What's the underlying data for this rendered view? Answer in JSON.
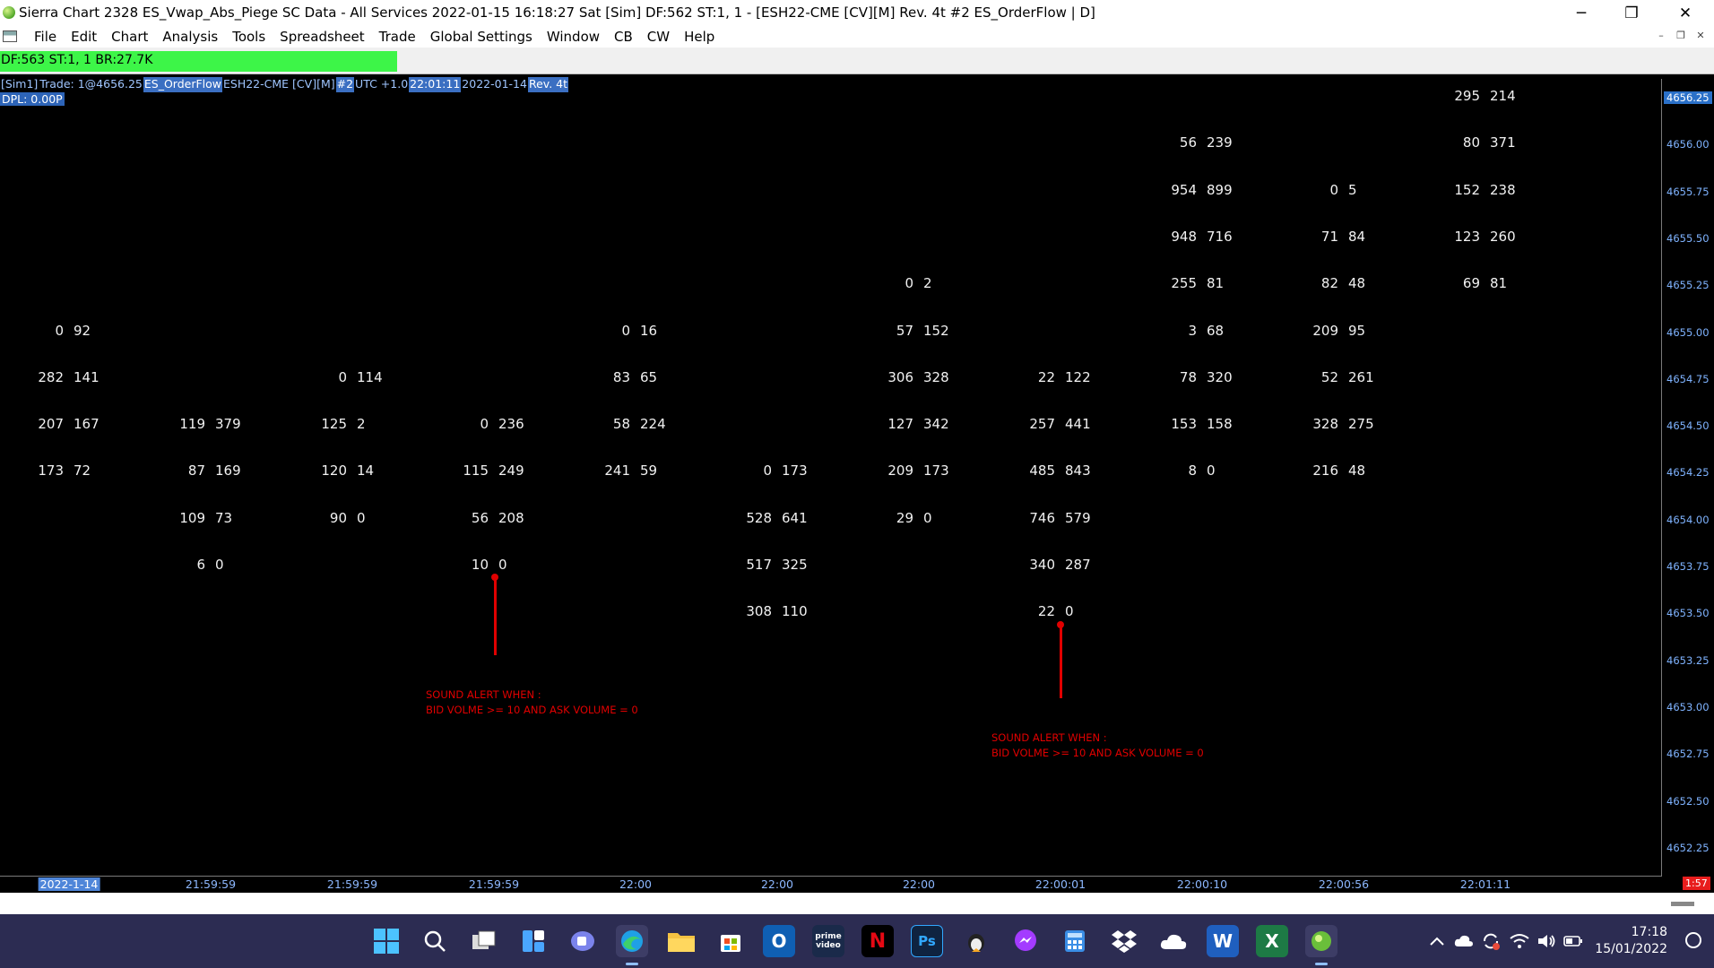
{
  "window": {
    "title": "Sierra Chart 2328 ES_Vwap_Abs_Piege  SC Data - All Services 2022-01-15  16:18:27 Sat [Sim]  DF:562  ST:1, 1 - [ESH22-CME [CV][M]  Rev. 4t  #2 ES_OrderFlow | D]",
    "minimize": "─",
    "restore": "❐",
    "close": "✕"
  },
  "menu": {
    "items": [
      "File",
      "Edit",
      "Chart",
      "Analysis",
      "Tools",
      "Spreadsheet",
      "Trade",
      "Global Settings",
      "Window",
      "CB",
      "CW",
      "Help"
    ],
    "mdi_minimize": "–",
    "mdi_restore": "❐",
    "mdi_close": "✕"
  },
  "controlbar": {
    "status": "DF:563  ST:1, 1   BR:27.7K"
  },
  "chart": {
    "info": {
      "sim": "[Sim1]",
      "trade": "Trade: 1@4656.25",
      "study": "ES_OrderFlow",
      "symbol": "ESH22-CME [CV][M]",
      "chart_num": "#2",
      "tz": "UTC +1.0",
      "time": "22:01:11",
      "date": "2022-01-14",
      "rev": "Rev. 4t"
    },
    "dpl": "DPL: 0.00P",
    "y_labels": [
      "4656.25",
      "4656.00",
      "4655.75",
      "4655.50",
      "4655.25",
      "4655.00",
      "4654.75",
      "4654.50",
      "4654.25",
      "4654.00",
      "4653.75",
      "4653.50",
      "4653.25",
      "4653.00",
      "4652.75",
      "4652.50",
      "4652.25"
    ],
    "x_labels": [
      "2022-1-14",
      "21:59:59",
      "21:59:59",
      "21:59:59",
      "22:00",
      "22:00",
      "22:00",
      "22:00:01",
      "22:00:10",
      "22:00:56",
      "22:01:11"
    ],
    "time_badge": "1:57",
    "footprint": [
      {
        "bar": 0,
        "cells": [
          {
            "price": "4655.00",
            "bid": "0",
            "ask": "92"
          },
          {
            "price": "4654.75",
            "bid": "282",
            "ask": "141"
          },
          {
            "price": "4654.50",
            "bid": "207",
            "ask": "167"
          },
          {
            "price": "4654.25",
            "bid": "173",
            "ask": "72"
          }
        ]
      },
      {
        "bar": 1,
        "cells": [
          {
            "price": "4654.50",
            "bid": "119",
            "ask": "379"
          },
          {
            "price": "4654.25",
            "bid": "87",
            "ask": "169"
          },
          {
            "price": "4654.00",
            "bid": "109",
            "ask": "73"
          },
          {
            "price": "4653.75",
            "bid": "6",
            "ask": "0"
          }
        ]
      },
      {
        "bar": 2,
        "cells": [
          {
            "price": "4654.75",
            "bid": "0",
            "ask": "114"
          },
          {
            "price": "4654.50",
            "bid": "125",
            "ask": "2"
          },
          {
            "price": "4654.25",
            "bid": "120",
            "ask": "14"
          },
          {
            "price": "4654.00",
            "bid": "90",
            "ask": "0"
          }
        ]
      },
      {
        "bar": 3,
        "cells": [
          {
            "price": "4654.50",
            "bid": "0",
            "ask": "236"
          },
          {
            "price": "4654.25",
            "bid": "115",
            "ask": "249"
          },
          {
            "price": "4654.00",
            "bid": "56",
            "ask": "208"
          },
          {
            "price": "4653.75",
            "bid": "10",
            "ask": "0"
          }
        ]
      },
      {
        "bar": 4,
        "cells": [
          {
            "price": "4655.00",
            "bid": "0",
            "ask": "16"
          },
          {
            "price": "4654.75",
            "bid": "83",
            "ask": "65"
          },
          {
            "price": "4654.50",
            "bid": "58",
            "ask": "224"
          },
          {
            "price": "4654.25",
            "bid": "241",
            "ask": "59"
          }
        ]
      },
      {
        "bar": 5,
        "cells": [
          {
            "price": "4654.25",
            "bid": "0",
            "ask": "173"
          },
          {
            "price": "4654.00",
            "bid": "528",
            "ask": "641"
          },
          {
            "price": "4653.75",
            "bid": "517",
            "ask": "325"
          },
          {
            "price": "4653.50",
            "bid": "308",
            "ask": "110"
          }
        ]
      },
      {
        "bar": 6,
        "cells": [
          {
            "price": "4655.25",
            "bid": "0",
            "ask": "2"
          },
          {
            "price": "4655.00",
            "bid": "57",
            "ask": "152"
          },
          {
            "price": "4654.75",
            "bid": "306",
            "ask": "328"
          },
          {
            "price": "4654.50",
            "bid": "127",
            "ask": "342"
          },
          {
            "price": "4654.25",
            "bid": "209",
            "ask": "173"
          },
          {
            "price": "4654.00",
            "bid": "29",
            "ask": "0"
          }
        ]
      },
      {
        "bar": 7,
        "cells": [
          {
            "price": "4654.75",
            "bid": "22",
            "ask": "122"
          },
          {
            "price": "4654.50",
            "bid": "257",
            "ask": "441"
          },
          {
            "price": "4654.25",
            "bid": "485",
            "ask": "843"
          },
          {
            "price": "4654.00",
            "bid": "746",
            "ask": "579"
          },
          {
            "price": "4653.75",
            "bid": "340",
            "ask": "287"
          },
          {
            "price": "4653.50",
            "bid": "22",
            "ask": "0"
          }
        ]
      },
      {
        "bar": 8,
        "cells": [
          {
            "price": "4656.00",
            "bid": "56",
            "ask": "239"
          },
          {
            "price": "4655.75",
            "bid": "954",
            "ask": "899"
          },
          {
            "price": "4655.50",
            "bid": "948",
            "ask": "716"
          },
          {
            "price": "4655.25",
            "bid": "255",
            "ask": "81"
          },
          {
            "price": "4655.00",
            "bid": "3",
            "ask": "68"
          },
          {
            "price": "4654.75",
            "bid": "78",
            "ask": "320"
          },
          {
            "price": "4654.50",
            "bid": "153",
            "ask": "158"
          },
          {
            "price": "4654.25",
            "bid": "8",
            "ask": "0"
          }
        ]
      },
      {
        "bar": 9,
        "cells": [
          {
            "price": "4655.75",
            "bid": "0",
            "ask": "5"
          },
          {
            "price": "4655.50",
            "bid": "71",
            "ask": "84"
          },
          {
            "price": "4655.25",
            "bid": "82",
            "ask": "48"
          },
          {
            "price": "4655.00",
            "bid": "209",
            "ask": "95"
          },
          {
            "price": "4654.75",
            "bid": "52",
            "ask": "261"
          },
          {
            "price": "4654.50",
            "bid": "328",
            "ask": "275"
          },
          {
            "price": "4654.25",
            "bid": "216",
            "ask": "48"
          }
        ]
      },
      {
        "bar": 10,
        "cells": [
          {
            "price": "4656.25",
            "bid": "295",
            "ask": "214"
          },
          {
            "price": "4656.00",
            "bid": "80",
            "ask": "371"
          },
          {
            "price": "4655.75",
            "bid": "152",
            "ask": "238"
          },
          {
            "price": "4655.50",
            "bid": "123",
            "ask": "260"
          },
          {
            "price": "4655.25",
            "bid": "69",
            "ask": "81"
          }
        ]
      }
    ],
    "alerts": [
      {
        "line1": "SOUND ALERT WHEN :",
        "line2": "BID VOLME >= 10 AND ASK VOLUME = 0"
      },
      {
        "line1": "SOUND ALERT WHEN :",
        "line2": "BID VOLME >= 10 AND ASK VOLUME = 0"
      }
    ]
  },
  "taskbar": {
    "icons": [
      "windows-start-icon",
      "search-icon",
      "task-view-icon",
      "widgets-icon",
      "teams-chat-icon",
      "edge-icon",
      "file-explorer-icon",
      "store-icon",
      "outlook-icon",
      "prime-video-icon",
      "netflix-icon",
      "photoshop-icon",
      "tux-icon",
      "messenger-icon",
      "calculator-icon",
      "dropbox-icon",
      "onedrive-icon",
      "word-icon",
      "excel-icon",
      "sierra-chart-icon"
    ],
    "glyphs": {
      "outlook": "O",
      "prime": "prime video",
      "netflix": "N",
      "photoshop": "Ps",
      "word": "W",
      "excel": "X"
    },
    "clock_time": "17:18",
    "clock_date": "15/01/2022",
    "colors": {
      "background": "#2c2c52",
      "accent": "#8fbfff"
    }
  }
}
